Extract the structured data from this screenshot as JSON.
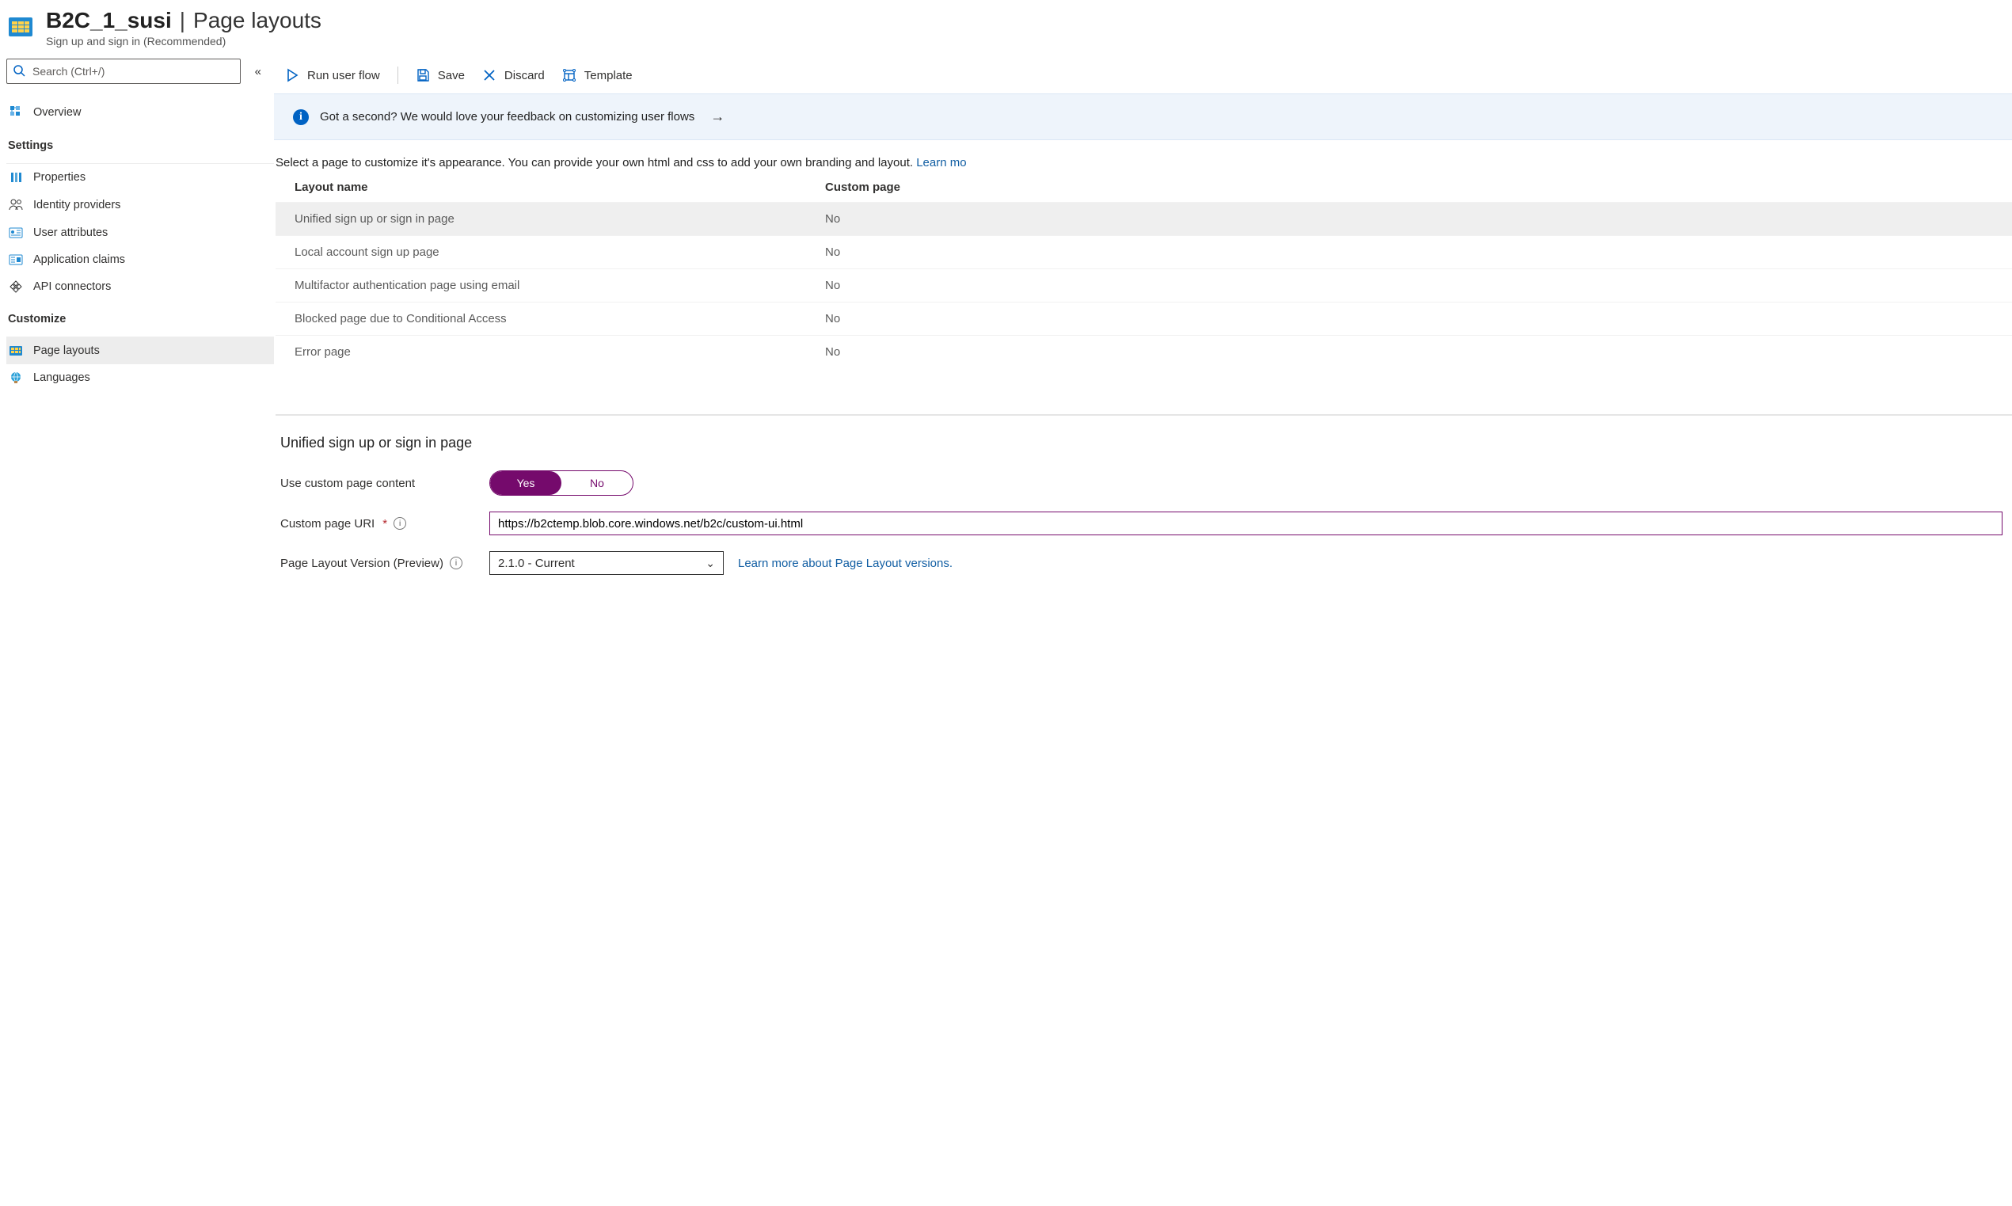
{
  "header": {
    "title_primary": "B2C_1_susi",
    "title_pipe": " | ",
    "title_secondary": "Page layouts",
    "subtitle": "Sign up and sign in (Recommended)"
  },
  "sidebar": {
    "search_placeholder": "Search (Ctrl+/)",
    "overview_label": "Overview",
    "group_settings": "Settings",
    "group_customize": "Customize",
    "items_settings": [
      {
        "label": "Properties"
      },
      {
        "label": "Identity providers"
      },
      {
        "label": "User attributes"
      },
      {
        "label": "Application claims"
      },
      {
        "label": "API connectors"
      }
    ],
    "items_customize": [
      {
        "label": "Page layouts"
      },
      {
        "label": "Languages"
      }
    ]
  },
  "toolbar": {
    "run": "Run user flow",
    "save": "Save",
    "discard": "Discard",
    "template": "Template"
  },
  "banner": {
    "text": "Got a second? We would love your feedback on customizing user flows"
  },
  "helper": {
    "text": "Select a page to customize it's appearance. You can provide your own html and css to add your own branding and layout. ",
    "link": "Learn mo"
  },
  "table": {
    "head_name": "Layout name",
    "head_custom": "Custom page",
    "rows": [
      {
        "name": "Unified sign up or sign in page",
        "custom": "No",
        "selected": true
      },
      {
        "name": "Local account sign up page",
        "custom": "No",
        "selected": false
      },
      {
        "name": "Multifactor authentication page using email",
        "custom": "No",
        "selected": false
      },
      {
        "name": "Blocked page due to Conditional Access",
        "custom": "No",
        "selected": false
      },
      {
        "name": "Error page",
        "custom": "No",
        "selected": false
      }
    ]
  },
  "detail": {
    "title": "Unified sign up or sign in page",
    "use_custom_label": "Use custom page content",
    "toggle_yes": "Yes",
    "toggle_no": "No",
    "uri_label": "Custom page URI",
    "uri_value": "https://b2ctemp.blob.core.windows.net/b2c/custom-ui.html",
    "version_label": "Page Layout Version (Preview)",
    "version_value": "2.1.0 - Current",
    "version_link": "Learn more about Page Layout versions."
  }
}
